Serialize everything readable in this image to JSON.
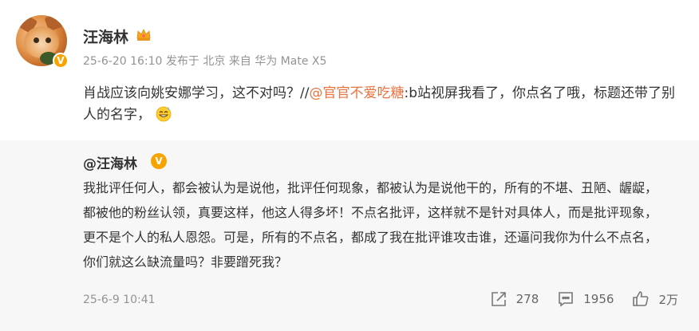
{
  "post": {
    "username": "汪海林",
    "meta": "25-6-20 16:10 发布于 北京 来自 华为 Mate X5",
    "text_before": "肖战应该向姚安娜学习，这不对吗？//",
    "mention": "@官官不爱吃糖",
    "text_after": ":b站视屏我看了，你点名了哦，标题还带了别人的名字，",
    "emoji_icon": "grinning-sweat-emoji"
  },
  "repost": {
    "username": "@汪海林",
    "verified_badge": "V",
    "text": "我批评任何人，都会被认为是说他，批评任何现象，都被认为是说他干的，所有的不堪、丑陋、龌龊，都被他的粉丝认领，真要这样，他这人得多坏！不点名批评，这样就不是针对具体人，而是批评现象，更不是个人的私人恩怨。可是，所有的不点名，都成了我在批评谁攻击谁，还逼问我你为什么不点名，你们就这么缺流量吗？非要蹭死我？",
    "time": "25-6-9 10:41",
    "actions": {
      "share_count": "278",
      "comment_count": "1956",
      "like_count": "2万"
    }
  },
  "colors": {
    "mention": "#eb7340",
    "verified": "#f7a400",
    "repost_bg": "#f7f7f7"
  }
}
